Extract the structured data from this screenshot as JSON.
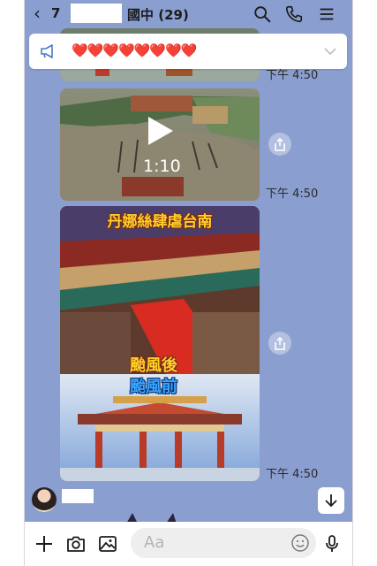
{
  "header": {
    "back_count": "7",
    "title": "國中 (29)"
  },
  "announcement": {
    "text": "❤️❤️❤️❤️❤️❤️❤️❤️"
  },
  "messages": [
    {
      "kind": "image",
      "time": "下午 4:50"
    },
    {
      "kind": "video",
      "duration": "1:10",
      "time": "下午 4:50"
    },
    {
      "kind": "image",
      "time": "下午 4:50",
      "caption_top": "丹娜絲肆虐台南",
      "caption_mid": "颱風後",
      "caption_bottom": "颱風前"
    }
  ],
  "composer": {
    "placeholder": "Aa"
  },
  "colors": {
    "background": "#8a9fd0",
    "heart": "#e0242b",
    "caption_yellow": "#ffd02b",
    "caption_blue": "#3aa5ff"
  }
}
